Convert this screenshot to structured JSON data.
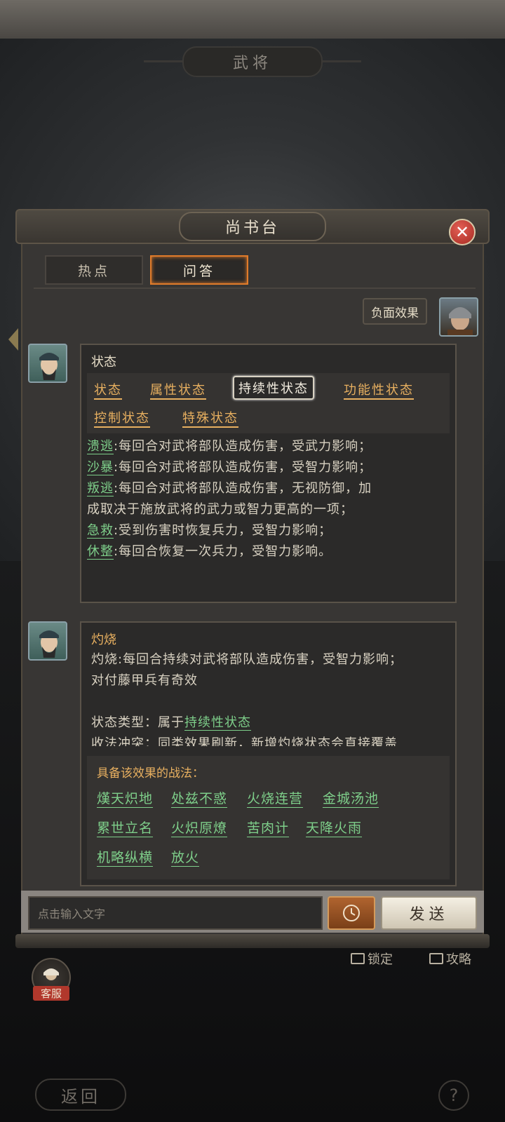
{
  "header": {
    "title": "武将"
  },
  "modal": {
    "title": "尚书台",
    "tabs": [
      {
        "label": "热点",
        "active": false
      },
      {
        "label": "问答",
        "active": true
      }
    ]
  },
  "user_message": {
    "text": "负面效果"
  },
  "reply1": {
    "title": "状态",
    "tags": [
      {
        "label": "状态",
        "active": false
      },
      {
        "label": "属性状态",
        "active": false
      },
      {
        "label": "持续性状态",
        "active": true
      },
      {
        "label": "功能性状态",
        "active": false
      },
      {
        "label": "控制状态",
        "active": false
      },
      {
        "label": "特殊状态",
        "active": false
      }
    ],
    "items": [
      {
        "keyword": "溃逃",
        "text": ":每回合对武将部队造成伤害，受武力影响；"
      },
      {
        "keyword": "沙暴",
        "text": ":每回合对武将部队造成伤害，受智力影响；"
      },
      {
        "keyword": "叛逃",
        "text": ":每回合对武将部队造成伤害，无视防御，加"
      },
      {
        "keyword": "",
        "text": "成取决于施放武将的武力或智力更高的一项；"
      },
      {
        "keyword": "急救",
        "text": ":受到伤害时恢复兵力，受智力影响；"
      },
      {
        "keyword": "休整",
        "text": ":每回合恢复一次兵力，受智力影响。"
      }
    ]
  },
  "reply2": {
    "title": "灼烧",
    "line1": "灼烧:每回合持续对武将部队造成伤害，受智力影响；",
    "line2": "对付藤甲兵有奇效",
    "type_prefix": "状态类型：属于",
    "type_link": "持续性状态",
    "line4_partial": "收法冲突：同类效果刷新，新增灼烧状态会直接覆盖",
    "tactics_header": "具备该效果的战法：",
    "tactics": [
      "熯天炽地",
      "处兹不惑",
      "火烧连营",
      "金城汤池",
      "累世立名",
      "火炽原燎",
      "苦肉计",
      "天降火雨",
      "机略纵横",
      "放火"
    ]
  },
  "input": {
    "placeholder": "点击输入文字",
    "send_label": "发送"
  },
  "background": {
    "lock_label": "锁定",
    "guide_label": "攻略",
    "service_label": "客服",
    "back_label": "返回",
    "help_label": "?"
  },
  "colors": {
    "accent_orange": "#e8b060",
    "keyword_green": "#7ecf8a",
    "tab_active_border": "#e07b2a",
    "close_red": "#c9392d"
  }
}
